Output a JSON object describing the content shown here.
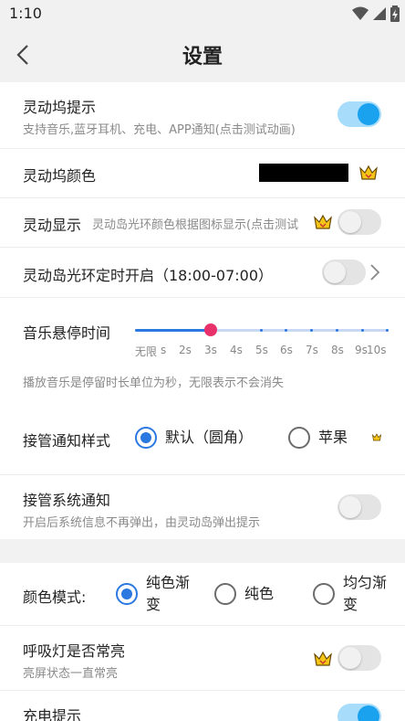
{
  "status": {
    "time": "1:10"
  },
  "header": {
    "title": "设置"
  },
  "rows": {
    "island_tip": {
      "title": "灵动坞提示",
      "subtitle": "支持音乐,蓝牙耳机、充电、APP通知(点击测试动画)",
      "enabled": true
    },
    "island_color": {
      "title": "灵动坞颜色",
      "color": "#000000"
    },
    "dynamic_display": {
      "title": "灵动显示",
      "hint": "灵动岛光环颜色根据图标显示(点击测试",
      "enabled": false
    },
    "ring_timer": {
      "title": "灵动岛光环定时开启（18:00-07:00）",
      "enabled": false
    },
    "music_hover": {
      "title": "音乐悬停时间",
      "tick_labels": [
        "无限",
        "s",
        "2s",
        "3s",
        "4s",
        "5s",
        "6s",
        "7s",
        "8s",
        "9s",
        "10s"
      ],
      "selected_index": 3,
      "note": "播放音乐是停留时长单位为秒，无限表示不会消失"
    },
    "notify_style": {
      "title": "接管通知样式",
      "options": [
        "默认（圆角）",
        "苹果"
      ],
      "selected": 0
    },
    "system_notify": {
      "title": "接管系统通知",
      "subtitle": "开启后系统信息不再弹出，由灵动岛弹出提示",
      "enabled": false
    },
    "color_mode": {
      "title": "颜色模式:",
      "options": [
        "纯色渐变",
        "纯色",
        "均匀渐变"
      ],
      "selected": 0
    },
    "breath_light": {
      "title": "呼吸灯是否常亮",
      "subtitle": "亮屏状态一直常亮",
      "enabled": false
    },
    "charge_tip": {
      "title": "充电提示",
      "enabled": true
    }
  },
  "colors": {
    "accent": "#2a78e0",
    "toggle_on": "#1aa2ef",
    "slider_thumb": "#e8306a",
    "crown": "#e8b400"
  }
}
